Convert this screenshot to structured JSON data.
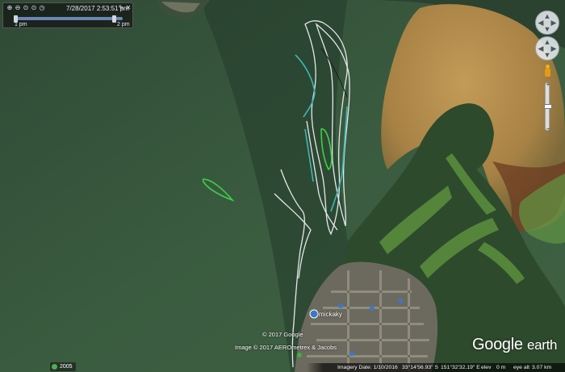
{
  "time_slider": {
    "datetime": "7/28/2017    2:53:51 pm",
    "start_label": "1 pm",
    "end_label": "2 pm",
    "progress": 0.92
  },
  "map": {
    "place_label": "mickaky",
    "copyright_google": "© 2017 Google",
    "copyright_image": "Image © 2017 AEROmetrex & Jacobs"
  },
  "logo": {
    "google": "Google",
    "earth": "earth"
  },
  "status_bar": {
    "imagery_date": "Imagery Date: 1/10/2016",
    "latitude": "33°14'56.93\" S",
    "longitude": "151°32'32.19\" E",
    "elev_label": "elev",
    "elev_value": "0 m",
    "eye_alt_label": "eye alt",
    "eye_alt_value": "3.07 km"
  },
  "historical_imagery": {
    "year": "2005"
  },
  "colors": {
    "water": "#3b5a40",
    "land": "#2f4a33",
    "sand": "#b08a4a",
    "track_white": "#e6e8ea",
    "track_cyan": "#3fb6b8",
    "track_green": "#3fcf4a"
  },
  "icons": {
    "zoom_in": "magnifier-plus-icon",
    "zoom_out": "magnifier-minus-icon",
    "settings": "wrench-icon",
    "close": "close-icon",
    "compass": "north-compass-icon",
    "pegman": "street-view-person-icon"
  }
}
